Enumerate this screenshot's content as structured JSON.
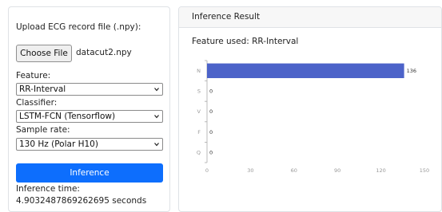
{
  "form": {
    "upload_label": "Upload ECG record file (.npy):",
    "choose_file_label": "Choose File",
    "file_name": "datacut2.npy",
    "feature_label": "Feature:",
    "feature_value": "RR-Interval",
    "classifier_label": "Classifier:",
    "classifier_value": "LSTM-FCN (Tensorflow)",
    "sample_rate_label": "Sample rate:",
    "sample_rate_value": "130 Hz (Polar H10)",
    "inference_button": "Inference",
    "inference_time": "Inference time: 4.9032487869262695 seconds"
  },
  "result": {
    "title": "Inference Result",
    "feature_used": "Feature used: RR-Interval"
  },
  "colors": {
    "primary_button": "#0d6efd",
    "bar": "#4c63c9"
  },
  "chart_data": {
    "type": "bar",
    "orientation": "horizontal",
    "categories": [
      "N",
      "S",
      "V",
      "F",
      "Q"
    ],
    "values": [
      136,
      0,
      0,
      0,
      0
    ],
    "value_labels": [
      "136",
      "0",
      "0",
      "0",
      "0"
    ],
    "x_ticks": [
      "0",
      "30",
      "60",
      "90",
      "120",
      "150"
    ],
    "xlim": [
      0,
      150
    ],
    "title": "",
    "xlabel": "",
    "ylabel": "",
    "grid": false,
    "legend": false
  }
}
